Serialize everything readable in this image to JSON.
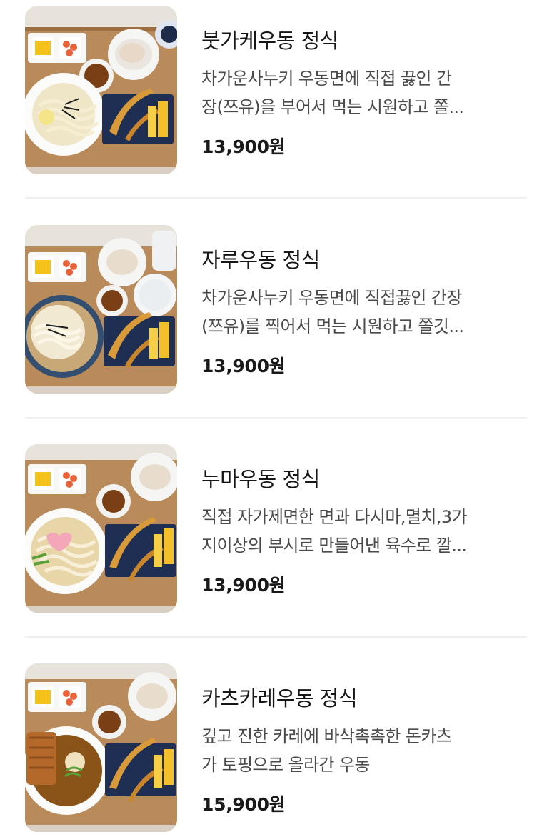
{
  "menu": {
    "items": [
      {
        "name": "붓가케우동 정식",
        "desc_line1": "차가운사누키 우동면에 직접 끓인 간",
        "desc_line2": "장(쯔유)을 부어서 먹는 시원하고 쫄...",
        "price": "13,900원",
        "image_icon": "bukkake-udon-set-photo"
      },
      {
        "name": "자루우동 정식",
        "desc_line1": "차가운사누키 우동면에 직접끓인 간장",
        "desc_line2": "(쯔유)를 찍어서 먹는 시원하고 쫄깃...",
        "price": "13,900원",
        "image_icon": "zaru-udon-set-photo"
      },
      {
        "name": "누마우동 정식",
        "desc_line1": "직접 자가제면한 면과 다시마,멸치,3가",
        "desc_line2": "지이상의 부시로 만들어낸 육수로 깔...",
        "price": "13,900원",
        "image_icon": "numa-udon-set-photo"
      },
      {
        "name": "카츠카레우동 정식",
        "desc_line1": "깊고 진한 카레에 바삭촉촉한 돈카츠",
        "desc_line2": "가 토핑으로 올라간 우동",
        "price": "15,900원",
        "image_icon": "katsu-curry-udon-set-photo"
      }
    ]
  }
}
